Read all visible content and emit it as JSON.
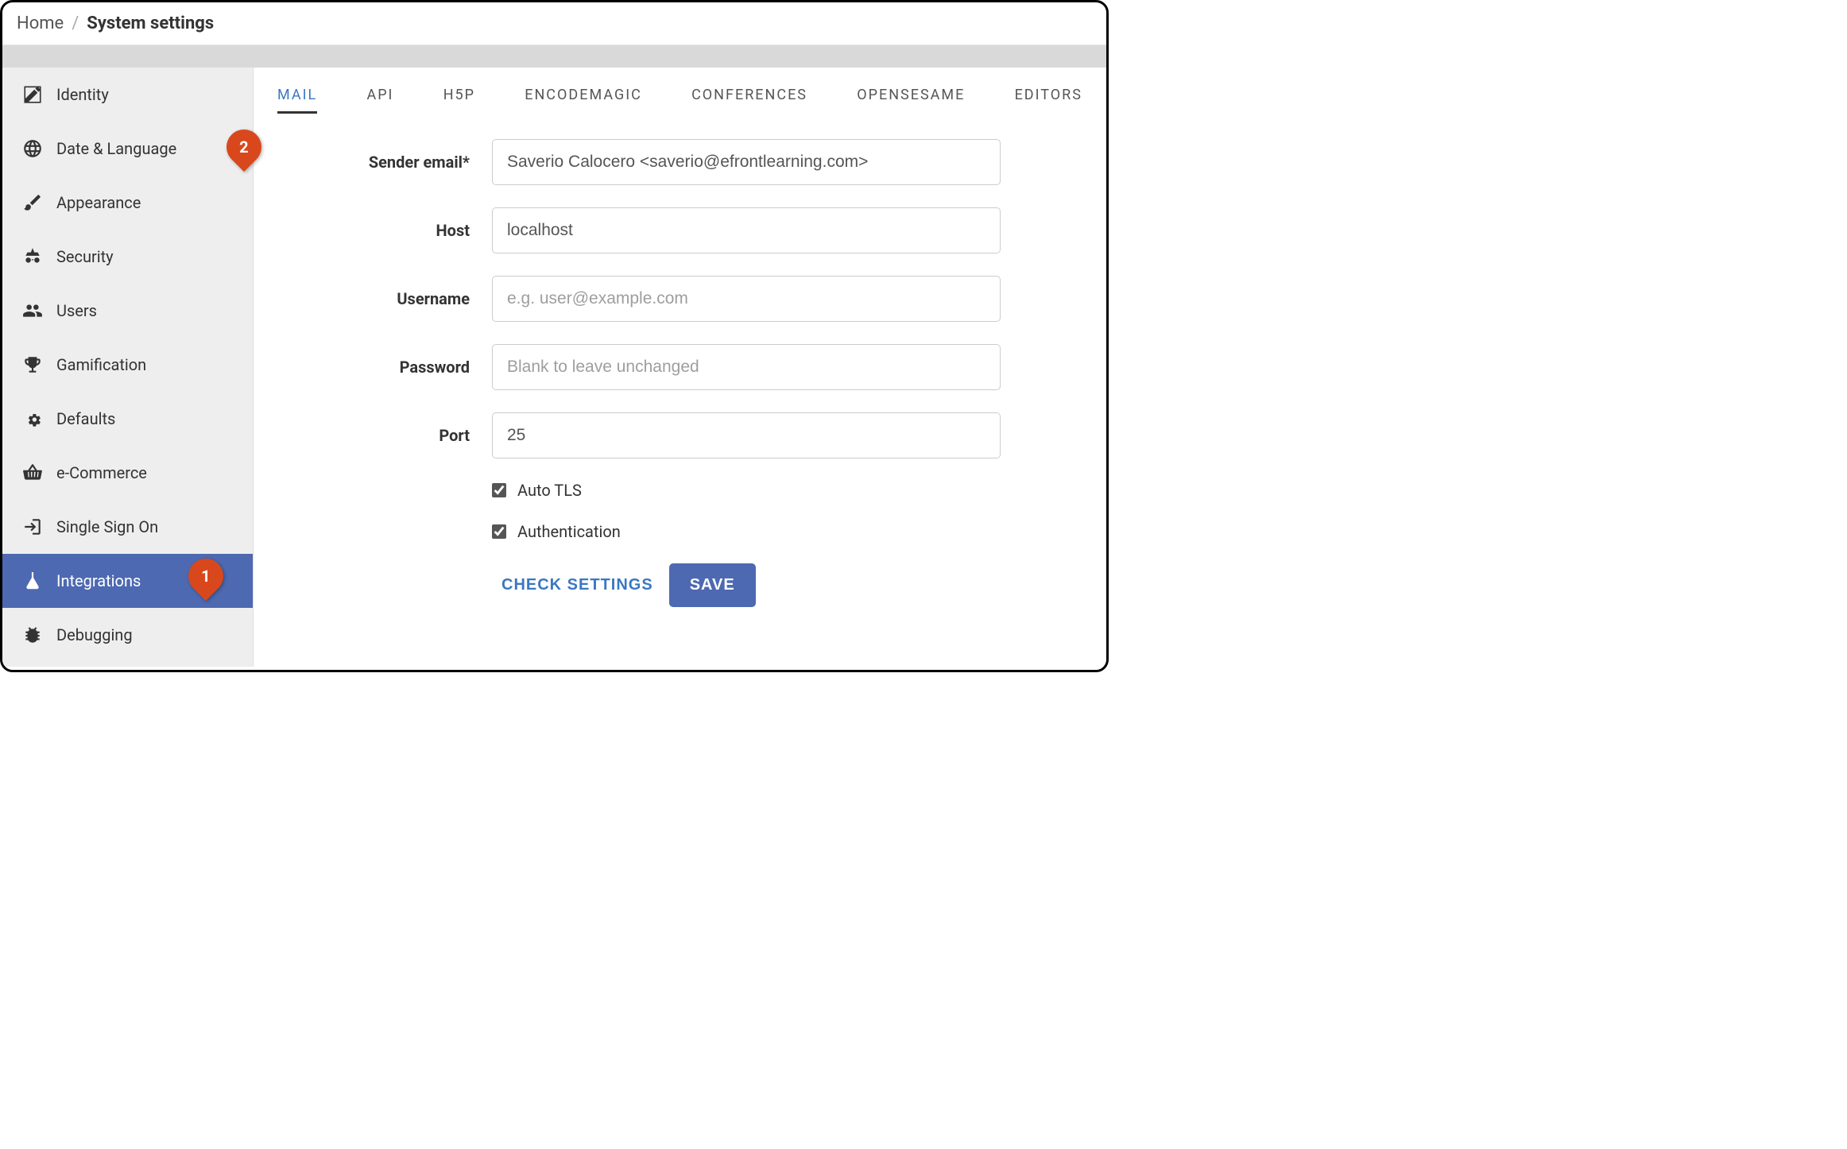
{
  "breadcrumb": {
    "home": "Home",
    "current": "System settings"
  },
  "sidebar": {
    "items": [
      {
        "label": "Identity"
      },
      {
        "label": "Date & Language"
      },
      {
        "label": "Appearance"
      },
      {
        "label": "Security"
      },
      {
        "label": "Users"
      },
      {
        "label": "Gamification"
      },
      {
        "label": "Defaults"
      },
      {
        "label": "e-Commerce"
      },
      {
        "label": "Single Sign On"
      },
      {
        "label": "Integrations"
      },
      {
        "label": "Debugging"
      }
    ]
  },
  "tabs": {
    "items": [
      {
        "label": "MAIL"
      },
      {
        "label": "API"
      },
      {
        "label": "H5P"
      },
      {
        "label": "ENCODEMAGIC"
      },
      {
        "label": "CONFERENCES"
      },
      {
        "label": "OPENSESAME"
      },
      {
        "label": "EDITORS"
      }
    ]
  },
  "form": {
    "sender_email": {
      "label": "Sender email*",
      "value": "Saverio Calocero <saverio@efrontlearning.com>"
    },
    "host": {
      "label": "Host",
      "value": "localhost"
    },
    "username": {
      "label": "Username",
      "value": "",
      "placeholder": "e.g. user@example.com"
    },
    "password": {
      "label": "Password",
      "value": "",
      "placeholder": "Blank to leave unchanged"
    },
    "port": {
      "label": "Port",
      "value": "25"
    },
    "auto_tls": {
      "label": "Auto TLS",
      "checked": true
    },
    "authentication": {
      "label": "Authentication",
      "checked": true
    }
  },
  "actions": {
    "check": "CHECK SETTINGS",
    "save": "SAVE"
  },
  "callouts": {
    "one": "1",
    "two": "2"
  }
}
